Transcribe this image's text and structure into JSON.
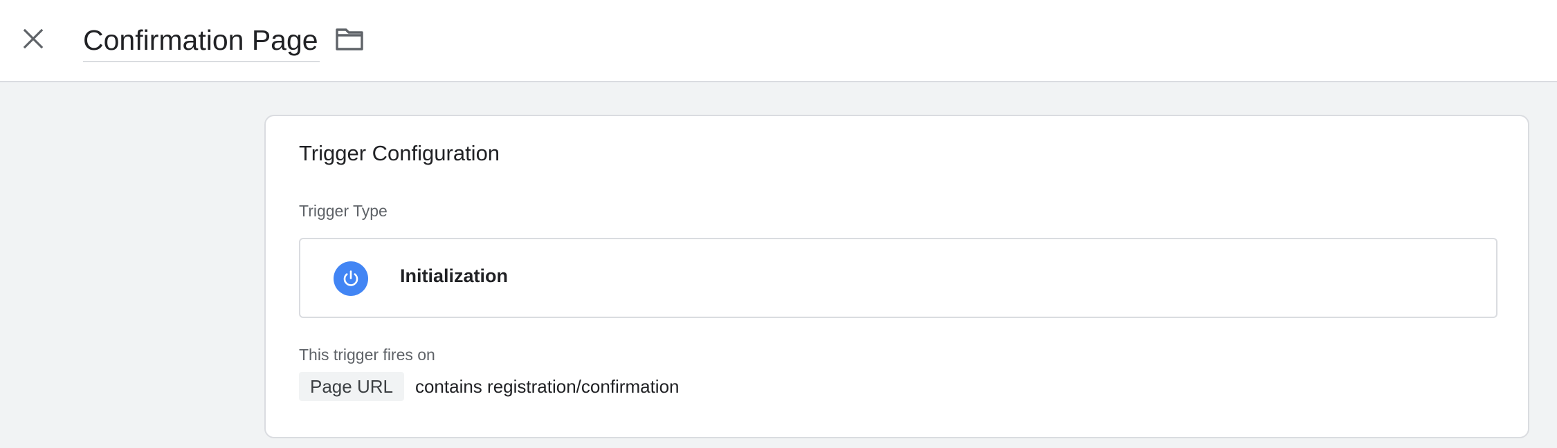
{
  "header": {
    "title": "Confirmation Page",
    "close_icon": "close-icon",
    "folder_icon": "folder-icon"
  },
  "card": {
    "title": "Trigger Configuration",
    "trigger_type_label": "Trigger Type",
    "trigger_type": {
      "name": "Initialization",
      "icon": "power-icon",
      "icon_color": "#4285f4"
    },
    "fires_on_label": "This trigger fires on",
    "condition": {
      "variable": "Page URL",
      "text": "contains registration/confirmation"
    }
  }
}
